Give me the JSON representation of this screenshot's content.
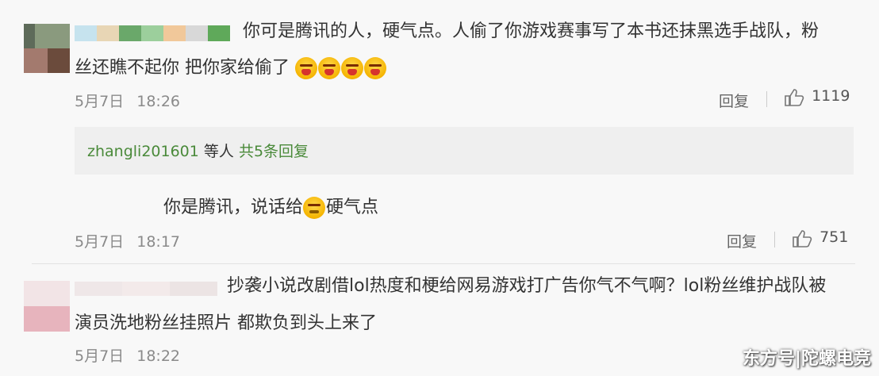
{
  "comments": [
    {
      "text_line1": "你可是腾讯的人，硬气点。人偷了你游戏赛事写了本书还抹黑选手战队，粉",
      "text_line2": "丝还瞧不起你 把你家给偷了",
      "emoji_icons": [
        "angry-face-icon",
        "angry-face-icon",
        "angry-face-icon",
        "angry-face-icon"
      ],
      "date": "5月7日",
      "time": "18:26",
      "reply_label": "回复",
      "like_count": "1119",
      "replies_summary": {
        "user": "zhangli201601",
        "middle": " 等人 ",
        "count_text": "共5条回复"
      }
    },
    {
      "text_before_emoji": "你是腾讯，说话给",
      "text_after_emoji": "硬气点",
      "emoji_icon": "face-icon",
      "date": "5月7日",
      "time": "18:17",
      "reply_label": "回复",
      "like_count": "751"
    },
    {
      "text_line1": "抄袭小说改剧借lol热度和梗给网易游戏打广告你气不气啊？lol粉丝维护战队被",
      "text_line2": "演员洗地粉丝挂照片 都欺负到头上来了",
      "date": "5月7日",
      "time": "18:22"
    }
  ],
  "watermark": "东方号|陀螺电竞",
  "colors": {
    "link_green": "#4a8a3a",
    "meta_gray": "#8a8a8a",
    "text": "#333333",
    "background": "#f8f8f8"
  }
}
